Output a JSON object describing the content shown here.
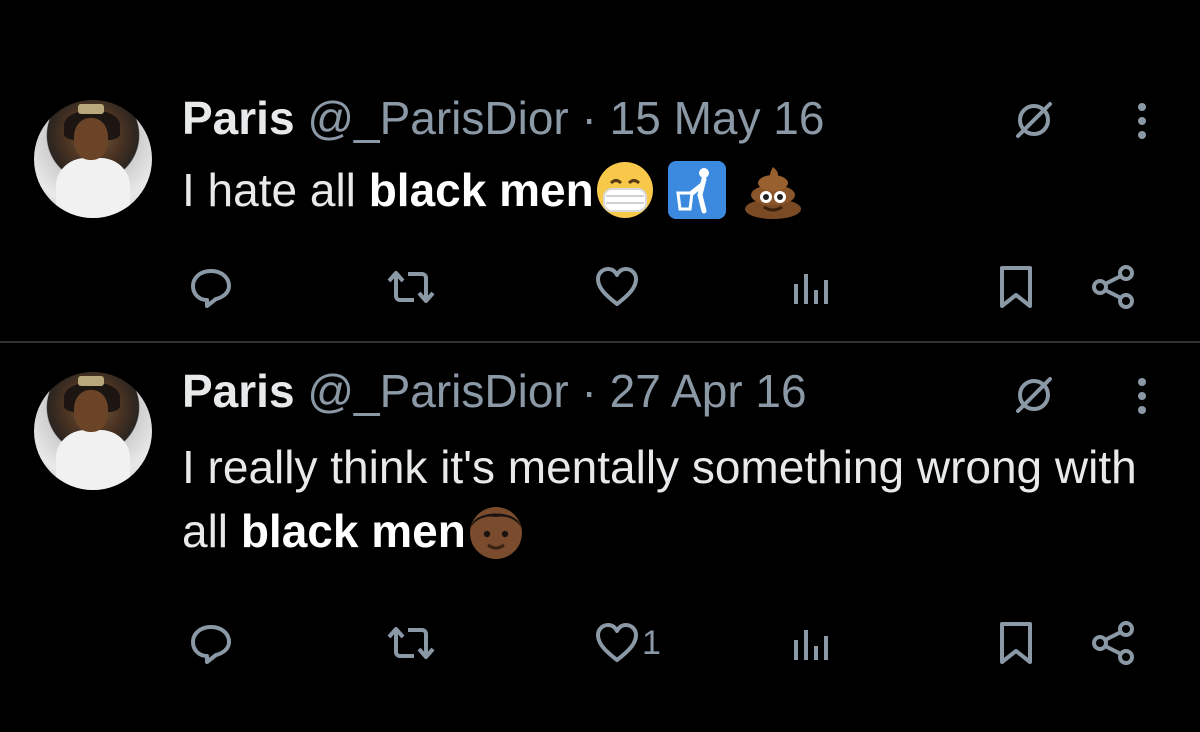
{
  "tweets": [
    {
      "name": "Paris",
      "handle": "@_ParisDior",
      "separator": "·",
      "date": "15 May 16",
      "text_before": "I hate all ",
      "text_bold": "black men",
      "emojis": [
        "face-with-medical-mask",
        "put-litter-in-its-place",
        "pile-of-poo"
      ],
      "like_count": ""
    },
    {
      "name": "Paris",
      "handle": "@_ParisDior",
      "separator": "·",
      "date": "27 Apr 16",
      "text_before": "I really think it's mentally something wrong with all ",
      "text_bold": "black men",
      "emojis": [
        "boy-medium-dark-skin-tone"
      ],
      "like_count": "1"
    }
  ],
  "icons": [
    "reply-icon",
    "retweet-icon",
    "like-icon",
    "views-icon",
    "bookmark-icon",
    "share-icon",
    "grok-icon",
    "more-icon"
  ],
  "colors": {
    "background": "#000000",
    "text": "#e7e9ea",
    "muted": "#8b98a5",
    "divider": "#2f3336"
  }
}
